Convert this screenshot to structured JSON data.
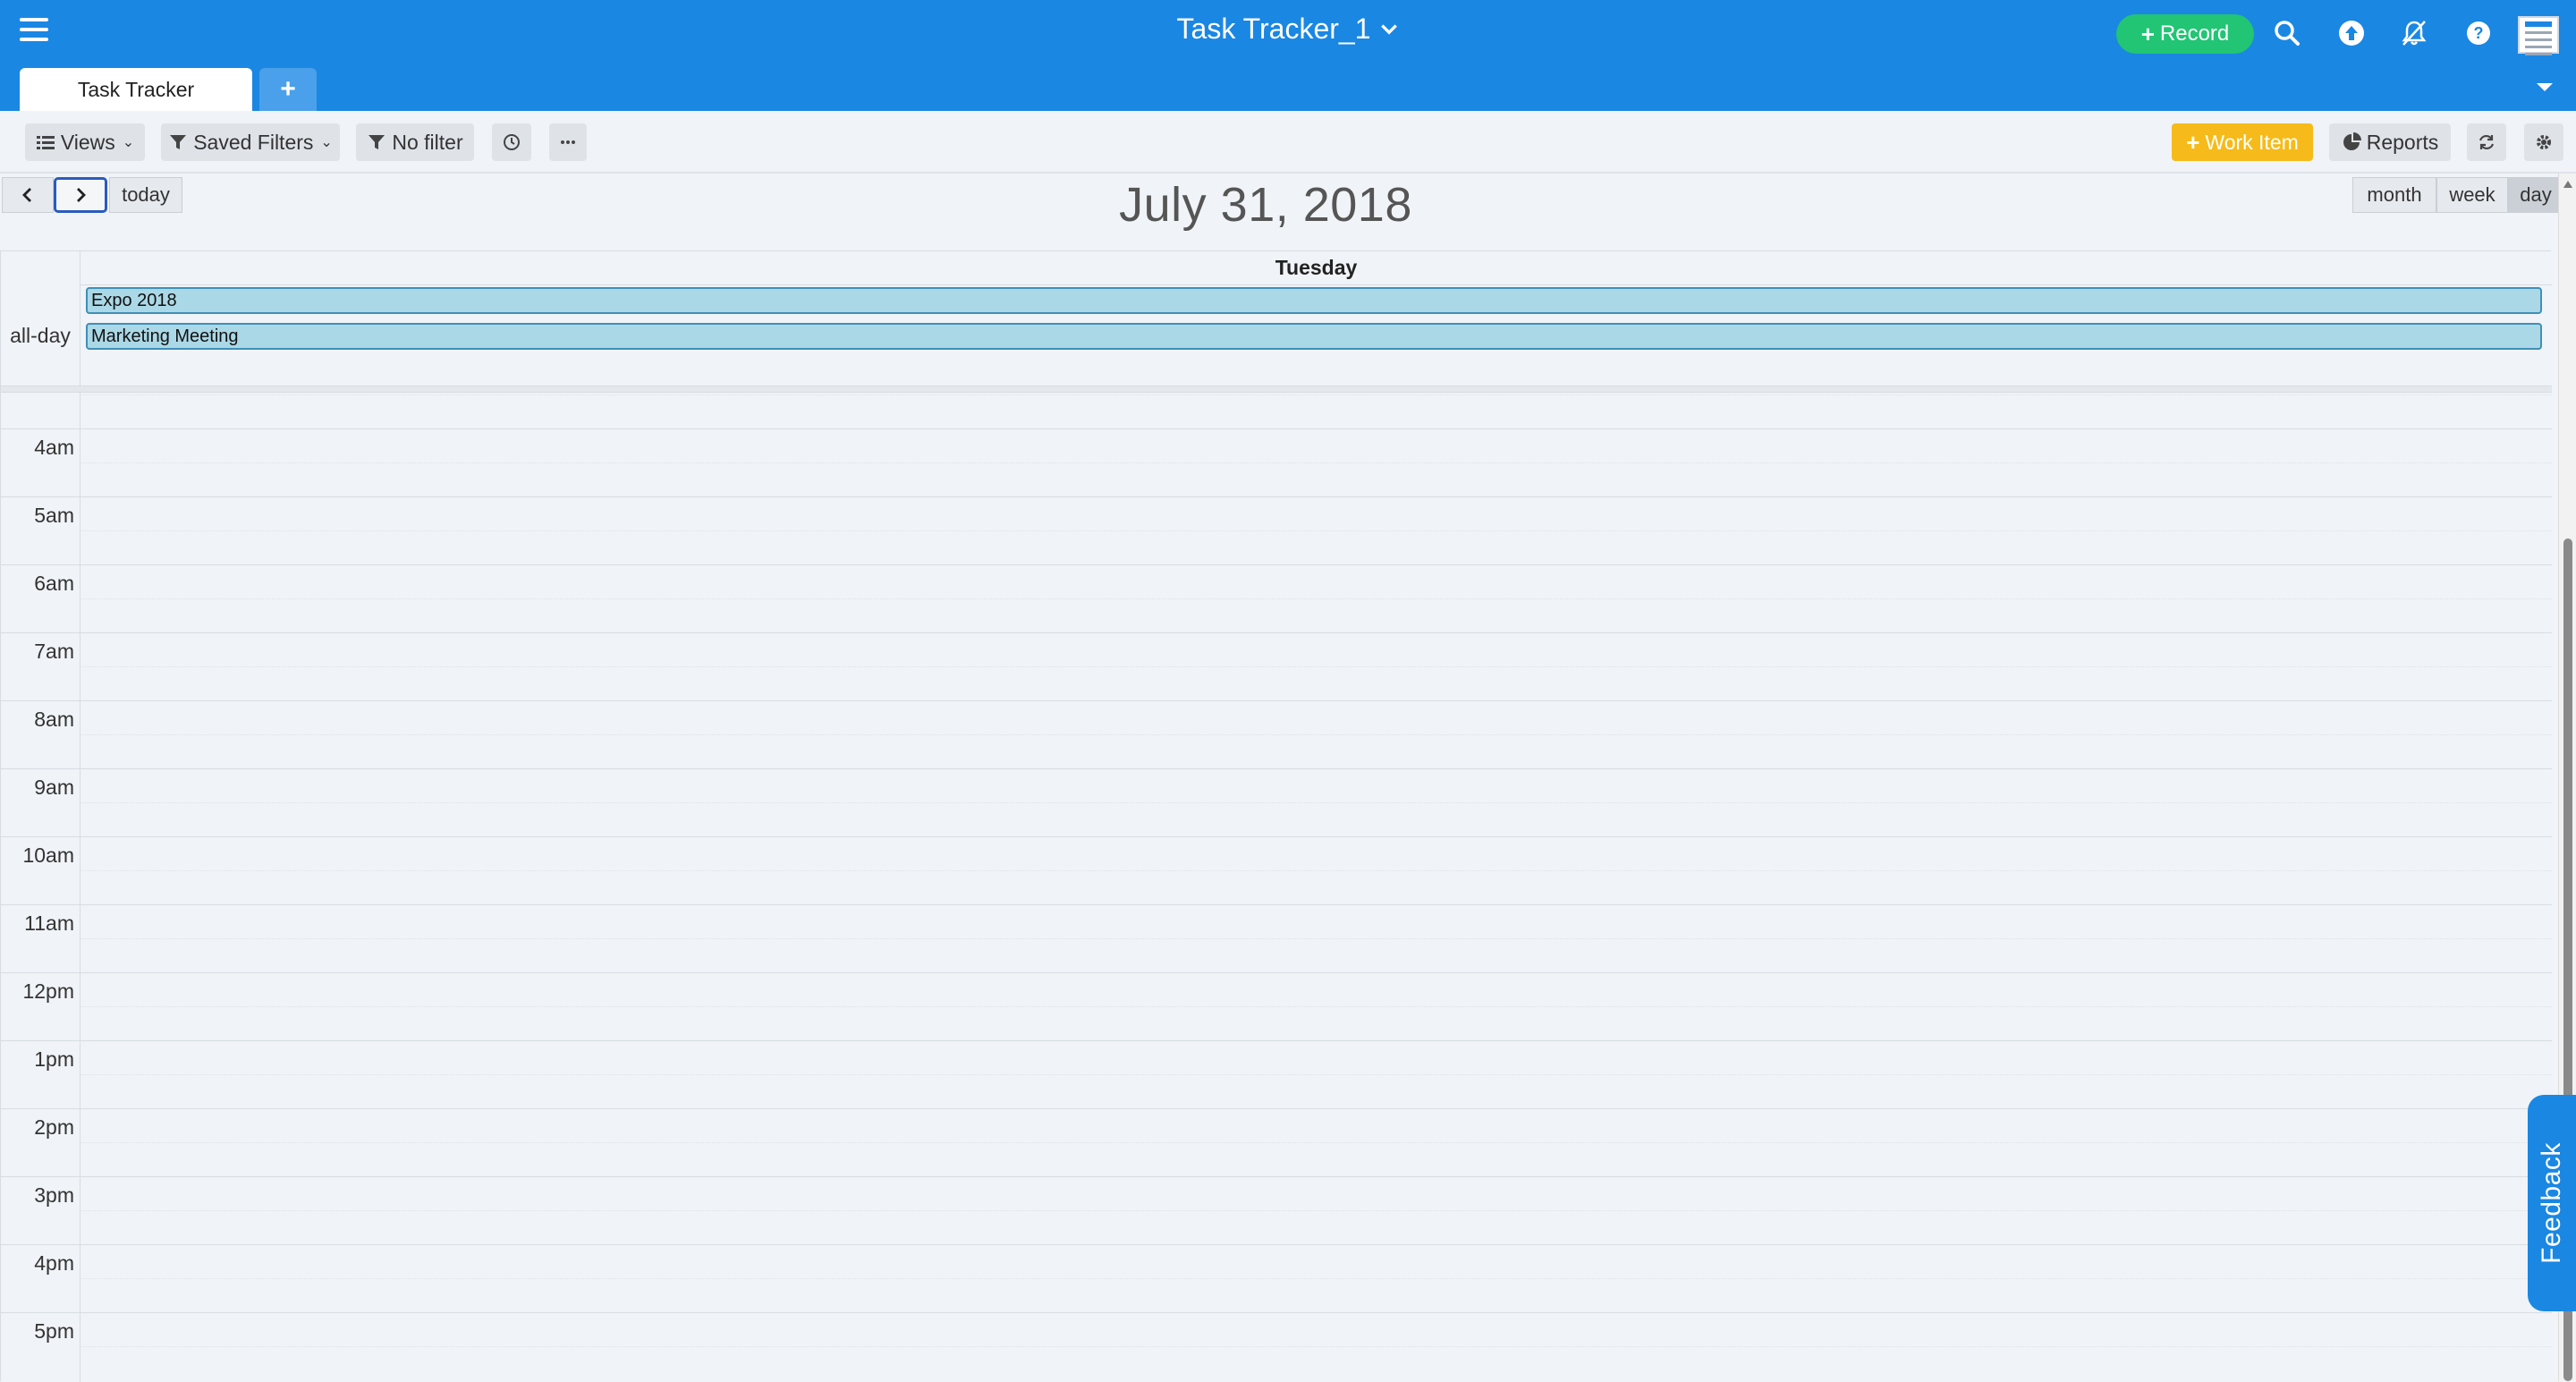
{
  "header": {
    "app_title": "Task Tracker_1",
    "record_label": "Record"
  },
  "tabs": {
    "active_label": "Task Tracker",
    "add_label": "+"
  },
  "toolbar": {
    "views_label": "Views",
    "saved_filters_label": "Saved Filters",
    "no_filter_label": "No filter",
    "work_item_label": "Work Item",
    "reports_label": "Reports"
  },
  "calendar": {
    "today_label": "today",
    "title": "July 31, 2018",
    "views": [
      "month",
      "week",
      "day"
    ],
    "active_view": "day",
    "day_name": "Tuesday",
    "all_day_label": "all-day",
    "all_day_events": [
      "Expo 2018",
      "Marketing Meeting"
    ],
    "hours": [
      "4am",
      "5am",
      "6am",
      "7am",
      "8am",
      "9am",
      "10am",
      "11am",
      "12pm",
      "1pm",
      "2pm",
      "3pm",
      "4pm",
      "5pm"
    ]
  },
  "feedback_label": "Feedback",
  "colors": {
    "header_bg": "#1a87e3",
    "record_green": "#21c574",
    "work_item_yellow": "#f6bb1a",
    "event_bg": "#abd8e6",
    "event_border": "#3f8fb6"
  },
  "icons": {
    "menu": "hamburger-icon",
    "search": "search-icon",
    "upload": "upload-icon",
    "notifications": "bell-off-icon",
    "help": "help-icon",
    "refresh": "refresh-icon",
    "settings": "gear-icon"
  }
}
